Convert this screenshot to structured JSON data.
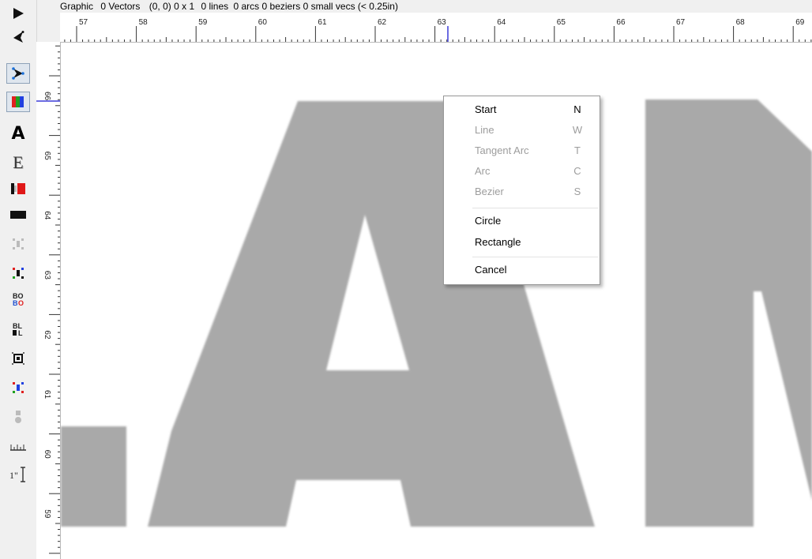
{
  "status": {
    "type": "Graphic",
    "vectors": "0 Vectors",
    "coords": "(0, 0)",
    "size": "0 x 1",
    "lines": "0 lines",
    "arcs": "0 arcs",
    "beziers": "0 beziers",
    "small_vecs": "0 small vecs (< 0.25in)"
  },
  "ruler_h": {
    "labels": [
      "57",
      "58",
      "59",
      "60",
      "61",
      "62",
      "63",
      "64",
      "65",
      "66",
      "67",
      "68",
      "69"
    ]
  },
  "ruler_v": {
    "labels": [
      "66",
      "65",
      "64",
      "63",
      "62",
      "61",
      "60",
      "59"
    ]
  },
  "toolbar": {
    "items": [
      {
        "name": "select-arrow-icon",
        "label": "▶"
      },
      {
        "name": "node-edit-icon",
        "label": "◂"
      },
      {
        "name": "vector-draw-icon",
        "label": "◢"
      },
      {
        "name": "color-palette-icon",
        "label": ""
      },
      {
        "name": "text-tool-icon",
        "label": "A"
      },
      {
        "name": "engrave-text-icon",
        "label": "E"
      },
      {
        "name": "color-split-icon",
        "label": ""
      },
      {
        "name": "fill-rectangle-icon",
        "label": ""
      },
      {
        "name": "node-disabled-icon",
        "label": "⋯"
      },
      {
        "name": "node-color-icon",
        "label": "⋯"
      },
      {
        "name": "bring-order-icon",
        "label": "BO"
      },
      {
        "name": "break-lines-icon",
        "label": "BL"
      },
      {
        "name": "bounding-box-icon",
        "label": "◘"
      },
      {
        "name": "group-select-icon",
        "label": "⋯"
      },
      {
        "name": "weld-point-icon",
        "label": "•"
      },
      {
        "name": "measure-ruler-icon",
        "label": "⊥"
      },
      {
        "name": "text-height-icon",
        "label": "1\""
      }
    ]
  },
  "context_menu": {
    "items": [
      {
        "label": "Start",
        "key": "N",
        "enabled": true
      },
      {
        "label": "Line",
        "key": "W",
        "enabled": false
      },
      {
        "label": "Tangent Arc",
        "key": "T",
        "enabled": false
      },
      {
        "label": "Arc",
        "key": "C",
        "enabled": false
      },
      {
        "label": "Bezier",
        "key": "S",
        "enabled": false
      },
      {
        "label": "Circle",
        "key": "",
        "enabled": true
      },
      {
        "label": "Rectangle",
        "key": "",
        "enabled": true
      },
      {
        "label": "Cancel",
        "key": "",
        "enabled": true
      }
    ]
  },
  "colors": {
    "letter_gray": "#a9a9a9",
    "disabled_text": "#9d9d9d",
    "ruler_marker": "#3b3bd9",
    "toolbar_bg": "#f0f0f0"
  }
}
